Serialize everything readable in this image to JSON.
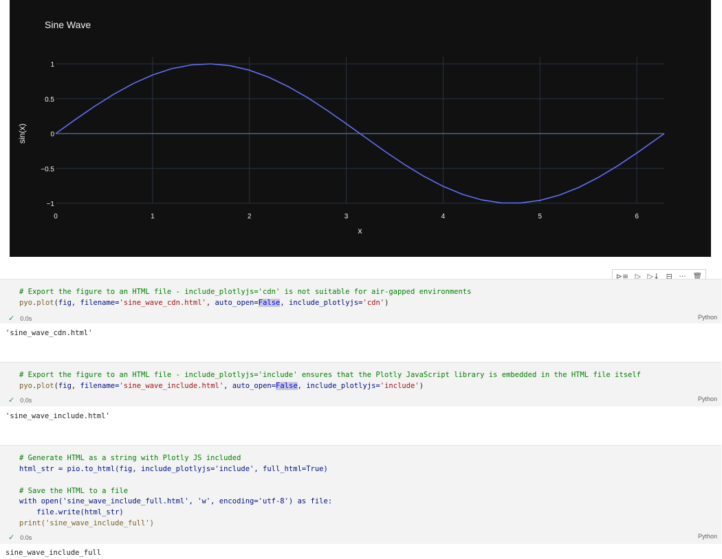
{
  "chart_data": {
    "type": "line",
    "title": "Sine Wave",
    "xlabel": "x",
    "ylabel": "sin(x)",
    "xlim": [
      0,
      6.2832
    ],
    "ylim": [
      -1,
      1
    ],
    "xticks": [
      "0",
      "1",
      "2",
      "3",
      "4",
      "5",
      "6"
    ],
    "yticks": [
      "1",
      "0.5",
      "0",
      "−0.5",
      "−1"
    ],
    "grid": true,
    "series": [
      {
        "color": "#636efa",
        "x": [
          0,
          0.2,
          0.4,
          0.6,
          0.8,
          1.0,
          1.2,
          1.4,
          1.6,
          1.8,
          2.0,
          2.2,
          2.4,
          2.6,
          2.8,
          3.0,
          3.2,
          3.4,
          3.6,
          3.8,
          4.0,
          4.2,
          4.4,
          4.6,
          4.8,
          5.0,
          5.2,
          5.4,
          5.6,
          5.8,
          6.0,
          6.2,
          6.2832
        ],
        "y": [
          0,
          0.199,
          0.389,
          0.565,
          0.717,
          0.841,
          0.932,
          0.985,
          1.0,
          0.974,
          0.909,
          0.808,
          0.675,
          0.516,
          0.335,
          0.141,
          -0.058,
          -0.256,
          -0.443,
          -0.612,
          -0.757,
          -0.872,
          -0.952,
          -0.994,
          -0.996,
          -0.959,
          -0.883,
          -0.773,
          -0.631,
          -0.465,
          -0.279,
          -0.083,
          0
        ]
      }
    ]
  },
  "toolbar": {
    "run_above": "⊳≡",
    "run_below": "▷↓",
    "run_down": "▷↓",
    "split": "⊟",
    "more": "···",
    "delete": "🗑"
  },
  "cells": [
    {
      "comment": "# Export the figure to an HTML file - include_plotlyjs='cdn' is not suitable for air-gapped environments",
      "line2": {
        "mod": "pyo",
        "fn": "plot",
        "a1": "fig",
        "k1": "filename=",
        "s1": "'sine_wave_cdn.html'",
        "k2": "auto_open=",
        "v2": "False",
        "k3": "include_plotlyjs=",
        "s3": "'cdn'"
      },
      "time": "0.0s",
      "lang": "Python",
      "output": "'sine_wave_cdn.html'"
    },
    {
      "comment": "# Export the figure to an HTML file - include_plotlyjs='include' ensures that the Plotly JavaScript library is embedded in the HTML file itself",
      "line2": {
        "mod": "pyo",
        "fn": "plot",
        "a1": "fig",
        "k1": "filename=",
        "s1": "'sine_wave_include.html'",
        "k2": "auto_open=",
        "v2": "False",
        "k3": "include_plotlyjs=",
        "s3": "'include'"
      },
      "time": "0.0s",
      "lang": "Python",
      "output": "'sine_wave_include.html'"
    },
    {
      "comment1": "# Generate HTML as a string with Plotly JS included",
      "line2": "html_str = pio.to_html(fig, include_plotlyjs='include', full_html=True)",
      "comment2": "# Save the HTML to a file",
      "line5": "with open('sine_wave_include_full.html', 'w', encoding='utf-8') as file:",
      "line6": "    file.write(html_str)",
      "line7": "print('sine_wave_include_full')",
      "time": "0.0s",
      "lang": "Python",
      "output": "sine_wave_include_full"
    }
  ]
}
